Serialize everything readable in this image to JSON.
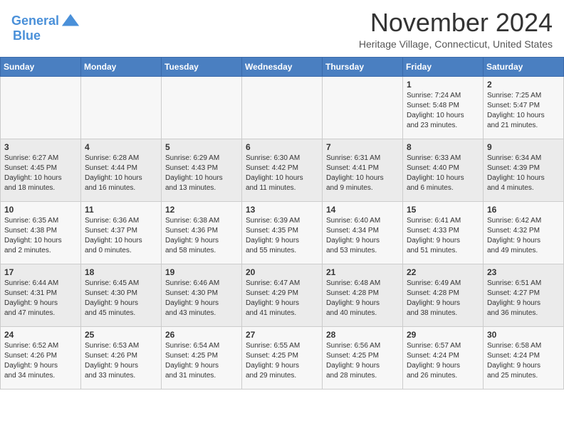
{
  "header": {
    "logo_line1": "General",
    "logo_line2": "Blue",
    "title": "November 2024",
    "subtitle": "Heritage Village, Connecticut, United States"
  },
  "calendar": {
    "days_of_week": [
      "Sunday",
      "Monday",
      "Tuesday",
      "Wednesday",
      "Thursday",
      "Friday",
      "Saturday"
    ],
    "weeks": [
      [
        {
          "day": "",
          "info": ""
        },
        {
          "day": "",
          "info": ""
        },
        {
          "day": "",
          "info": ""
        },
        {
          "day": "",
          "info": ""
        },
        {
          "day": "",
          "info": ""
        },
        {
          "day": "1",
          "info": "Sunrise: 7:24 AM\nSunset: 5:48 PM\nDaylight: 10 hours\nand 23 minutes."
        },
        {
          "day": "2",
          "info": "Sunrise: 7:25 AM\nSunset: 5:47 PM\nDaylight: 10 hours\nand 21 minutes."
        }
      ],
      [
        {
          "day": "3",
          "info": "Sunrise: 6:27 AM\nSunset: 4:45 PM\nDaylight: 10 hours\nand 18 minutes."
        },
        {
          "day": "4",
          "info": "Sunrise: 6:28 AM\nSunset: 4:44 PM\nDaylight: 10 hours\nand 16 minutes."
        },
        {
          "day": "5",
          "info": "Sunrise: 6:29 AM\nSunset: 4:43 PM\nDaylight: 10 hours\nand 13 minutes."
        },
        {
          "day": "6",
          "info": "Sunrise: 6:30 AM\nSunset: 4:42 PM\nDaylight: 10 hours\nand 11 minutes."
        },
        {
          "day": "7",
          "info": "Sunrise: 6:31 AM\nSunset: 4:41 PM\nDaylight: 10 hours\nand 9 minutes."
        },
        {
          "day": "8",
          "info": "Sunrise: 6:33 AM\nSunset: 4:40 PM\nDaylight: 10 hours\nand 6 minutes."
        },
        {
          "day": "9",
          "info": "Sunrise: 6:34 AM\nSunset: 4:39 PM\nDaylight: 10 hours\nand 4 minutes."
        }
      ],
      [
        {
          "day": "10",
          "info": "Sunrise: 6:35 AM\nSunset: 4:38 PM\nDaylight: 10 hours\nand 2 minutes."
        },
        {
          "day": "11",
          "info": "Sunrise: 6:36 AM\nSunset: 4:37 PM\nDaylight: 10 hours\nand 0 minutes."
        },
        {
          "day": "12",
          "info": "Sunrise: 6:38 AM\nSunset: 4:36 PM\nDaylight: 9 hours\nand 58 minutes."
        },
        {
          "day": "13",
          "info": "Sunrise: 6:39 AM\nSunset: 4:35 PM\nDaylight: 9 hours\nand 55 minutes."
        },
        {
          "day": "14",
          "info": "Sunrise: 6:40 AM\nSunset: 4:34 PM\nDaylight: 9 hours\nand 53 minutes."
        },
        {
          "day": "15",
          "info": "Sunrise: 6:41 AM\nSunset: 4:33 PM\nDaylight: 9 hours\nand 51 minutes."
        },
        {
          "day": "16",
          "info": "Sunrise: 6:42 AM\nSunset: 4:32 PM\nDaylight: 9 hours\nand 49 minutes."
        }
      ],
      [
        {
          "day": "17",
          "info": "Sunrise: 6:44 AM\nSunset: 4:31 PM\nDaylight: 9 hours\nand 47 minutes."
        },
        {
          "day": "18",
          "info": "Sunrise: 6:45 AM\nSunset: 4:30 PM\nDaylight: 9 hours\nand 45 minutes."
        },
        {
          "day": "19",
          "info": "Sunrise: 6:46 AM\nSunset: 4:30 PM\nDaylight: 9 hours\nand 43 minutes."
        },
        {
          "day": "20",
          "info": "Sunrise: 6:47 AM\nSunset: 4:29 PM\nDaylight: 9 hours\nand 41 minutes."
        },
        {
          "day": "21",
          "info": "Sunrise: 6:48 AM\nSunset: 4:28 PM\nDaylight: 9 hours\nand 40 minutes."
        },
        {
          "day": "22",
          "info": "Sunrise: 6:49 AM\nSunset: 4:28 PM\nDaylight: 9 hours\nand 38 minutes."
        },
        {
          "day": "23",
          "info": "Sunrise: 6:51 AM\nSunset: 4:27 PM\nDaylight: 9 hours\nand 36 minutes."
        }
      ],
      [
        {
          "day": "24",
          "info": "Sunrise: 6:52 AM\nSunset: 4:26 PM\nDaylight: 9 hours\nand 34 minutes."
        },
        {
          "day": "25",
          "info": "Sunrise: 6:53 AM\nSunset: 4:26 PM\nDaylight: 9 hours\nand 33 minutes."
        },
        {
          "day": "26",
          "info": "Sunrise: 6:54 AM\nSunset: 4:25 PM\nDaylight: 9 hours\nand 31 minutes."
        },
        {
          "day": "27",
          "info": "Sunrise: 6:55 AM\nSunset: 4:25 PM\nDaylight: 9 hours\nand 29 minutes."
        },
        {
          "day": "28",
          "info": "Sunrise: 6:56 AM\nSunset: 4:25 PM\nDaylight: 9 hours\nand 28 minutes."
        },
        {
          "day": "29",
          "info": "Sunrise: 6:57 AM\nSunset: 4:24 PM\nDaylight: 9 hours\nand 26 minutes."
        },
        {
          "day": "30",
          "info": "Sunrise: 6:58 AM\nSunset: 4:24 PM\nDaylight: 9 hours\nand 25 minutes."
        }
      ]
    ]
  }
}
